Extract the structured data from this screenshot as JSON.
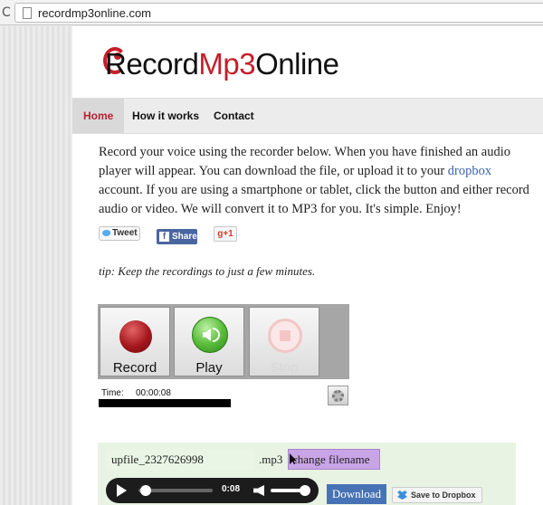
{
  "browser": {
    "url": "recordmp3online.com",
    "reload_icon": "reload-icon"
  },
  "logo": {
    "part1": "Record",
    "part2": "Mp3",
    "part3": "Online",
    "brand_color": "#c41f2c"
  },
  "nav": {
    "items": [
      {
        "label": "Home",
        "active": true
      },
      {
        "label": "How it works",
        "active": false
      },
      {
        "label": "Contact",
        "active": false
      }
    ]
  },
  "intro": {
    "text_before_link": "Record your voice using the recorder below. When you have finished an audio player will appear. You can download the file, or upload it to your ",
    "link": "dropbox",
    "text_after_link": " account. If you are using a smartphone or tablet, click the button and either record audio or video. We will convert it to MP3 for you. It's simple. Enjoy!"
  },
  "social": {
    "tweet": "Tweet",
    "share": "Share",
    "gplus": "g+1",
    "fb_glyph": "f"
  },
  "tip": "tip: Keep the recordings to just a few minutes.",
  "recorder": {
    "record_label": "Record",
    "play_label": "Play",
    "stop_label": "Stop",
    "time_label": "Time:",
    "time_value": "00:00:08"
  },
  "result": {
    "filename": "upfile_2327626998",
    "extension": ".mp3",
    "change_label": "change filename",
    "player_time": "0:08",
    "download_label": "Download",
    "dropbox_label": "Save to Dropbox"
  }
}
